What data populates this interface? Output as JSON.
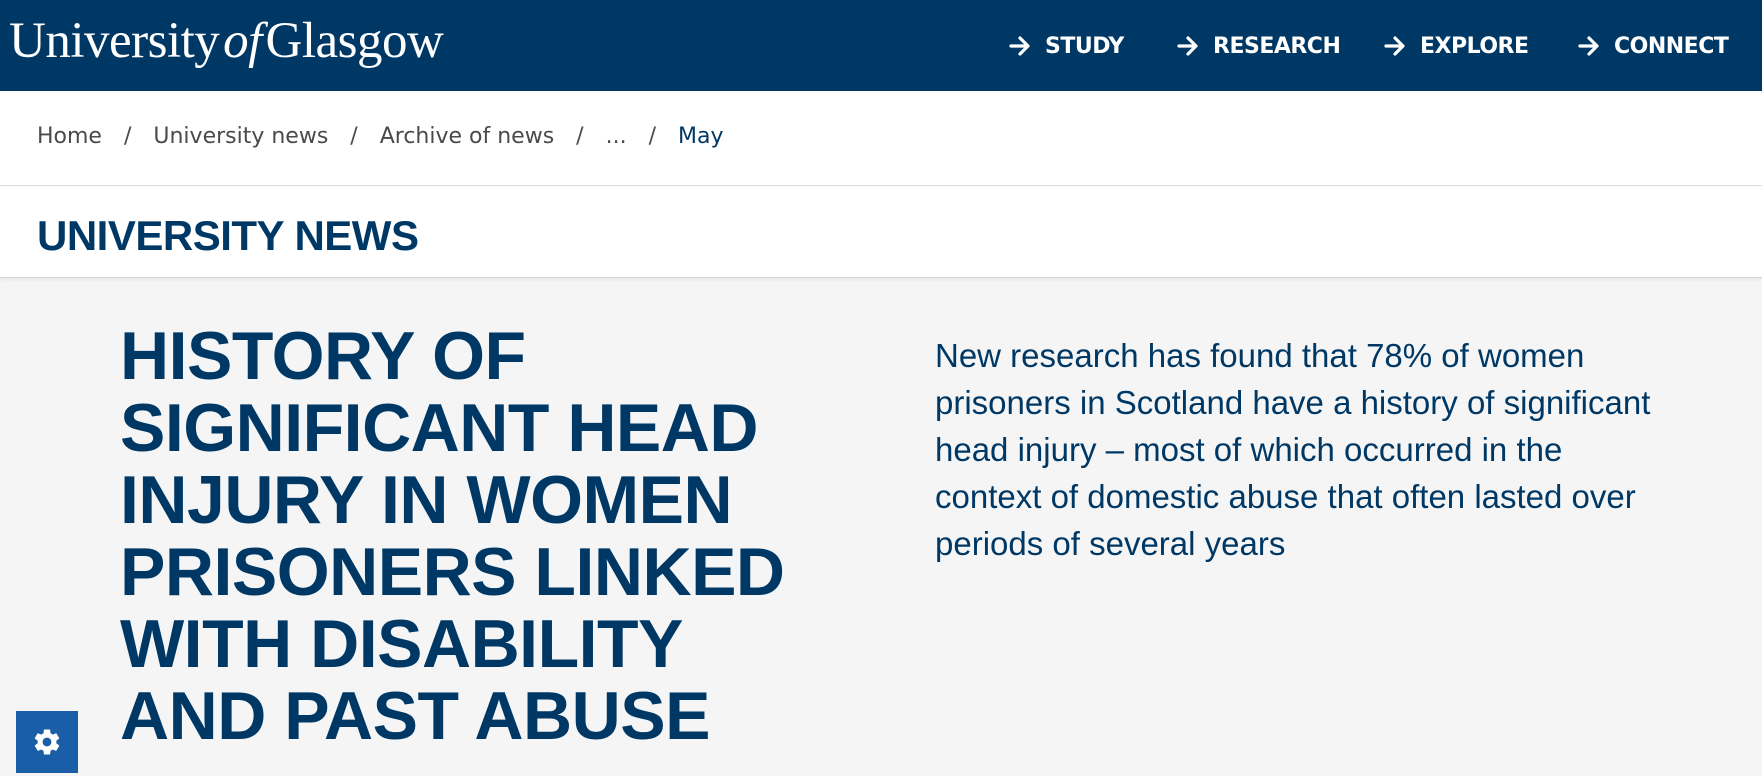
{
  "header": {
    "logo": {
      "text_university": "University",
      "text_of": "of",
      "text_glasgow": "Glasgow"
    },
    "nav": [
      {
        "label": "STUDY",
        "icon": "arrow-right-icon"
      },
      {
        "label": "RESEARCH",
        "icon": "arrow-right-icon"
      },
      {
        "label": "EXPLORE",
        "icon": "arrow-right-icon"
      },
      {
        "label": "CONNECT",
        "icon": "arrow-right-icon"
      }
    ]
  },
  "breadcrumb": {
    "items": [
      "Home",
      "University news",
      "Archive of news",
      "...",
      "May"
    ],
    "separator": "/"
  },
  "section": {
    "title": "UNIVERSITY NEWS"
  },
  "article": {
    "headline": "HISTORY OF SIGNIFICANT HEAD INJURY IN WOMEN PRISONERS LINKED WITH DISABILITY AND PAST ABUSE",
    "summary": "New research has found that 78% of women prisoners in Scotland have a history of significant head injury – most of which occurred in the context of domestic abuse that often lasted over periods of several years"
  },
  "settings_button": {
    "icon": "gear-icon"
  },
  "colors": {
    "brand": "#003865",
    "background": "#f5f5f5",
    "settings": "#1a5ea8"
  }
}
